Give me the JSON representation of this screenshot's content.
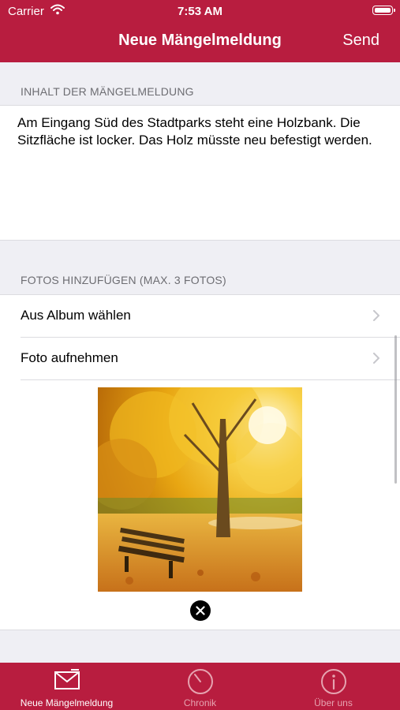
{
  "status_bar": {
    "carrier": "Carrier",
    "time": "7:53 AM"
  },
  "nav": {
    "title": "Neue Mängelmeldung",
    "send_label": "Send"
  },
  "content_section": {
    "header": "INHALT DER MÄNGELMELDUNG",
    "text": "Am Eingang Süd des Stadtparks steht eine Holzbank. Die Sitzfläche ist locker. Das Holz müsste neu befestigt werden."
  },
  "photos_section": {
    "header": "FOTOS HINZUFÜGEN (MAX. 3 FOTOS)",
    "rows": [
      {
        "label": "Aus Album wählen"
      },
      {
        "label": "Foto aufnehmen"
      }
    ]
  },
  "tab_bar": {
    "tabs": [
      {
        "label": "Neue Mängelmeldung",
        "icon": "envelope-icon",
        "selected": true
      },
      {
        "label": "Chronik",
        "icon": "clock-icon",
        "selected": false
      },
      {
        "label": "Über uns",
        "icon": "info-icon",
        "selected": false
      }
    ]
  },
  "colors": {
    "brand": "#b81d3f",
    "background": "#efeff4",
    "tab_inactive": "#e6a3b0"
  }
}
